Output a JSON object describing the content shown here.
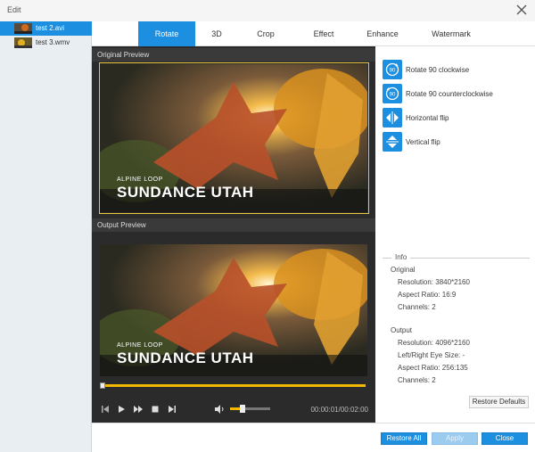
{
  "window": {
    "title": "Edit"
  },
  "files": [
    {
      "name": "test 2.avi",
      "selected": true
    },
    {
      "name": "test 3.wmv",
      "selected": false
    }
  ],
  "tabs": [
    {
      "label": "Rotate",
      "active": true
    },
    {
      "label": "3D",
      "active": false
    },
    {
      "label": "Crop",
      "active": false
    },
    {
      "label": "Effect",
      "active": false
    },
    {
      "label": "Enhance",
      "active": false
    },
    {
      "label": "Watermark",
      "active": false
    }
  ],
  "preview": {
    "original_label": "Original Preview",
    "output_label": "Output Preview",
    "caption_small": "ALPINE LOOP",
    "caption_big": "SUNDANCE UTAH",
    "time": "00:00:01/00:02:00",
    "progress": 0.02,
    "volume": 0.3
  },
  "actions": [
    {
      "label": "Rotate 90 clockwise",
      "icon": "rotate-clockwise-icon"
    },
    {
      "label": "Rotate 90 counterclockwise",
      "icon": "rotate-counterclockwise-icon"
    },
    {
      "label": "Horizontal flip",
      "icon": "horizontal-flip-icon"
    },
    {
      "label": "Vertical flip",
      "icon": "vertical-flip-icon"
    }
  ],
  "info": {
    "legend": "Info",
    "original_heading": "Original",
    "original": {
      "resolution": "Resolution: 3840*2160",
      "aspect": "Aspect Ratio: 16:9",
      "channels": "Channels: 2"
    },
    "output_heading": "Output",
    "output": {
      "resolution": "Resolution: 4096*2160",
      "eye": "Left/Right Eye Size: -",
      "aspect": "Aspect Ratio: 256:135",
      "channels": "Channels: 2"
    }
  },
  "buttons": {
    "restore_defaults": "Restore Defaults",
    "restore_all": "Restore All",
    "apply": "Apply",
    "close": "Close"
  },
  "colors": {
    "accent": "#1c8fe0",
    "crop_border": "#e8c63a",
    "progress": "#f0b800"
  }
}
